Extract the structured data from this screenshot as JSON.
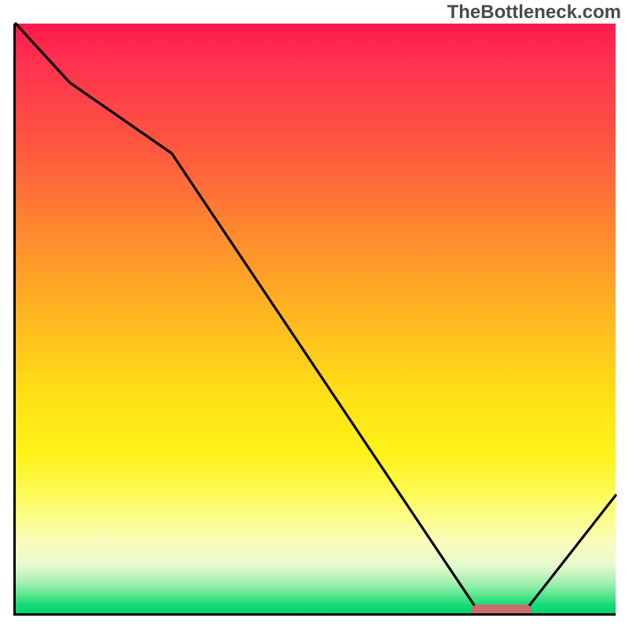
{
  "watermark": "TheBottleneck.com",
  "chart_data": {
    "type": "line",
    "x": [
      0,
      9,
      26,
      77,
      80,
      85,
      100
    ],
    "values": [
      100,
      90,
      78,
      0.5,
      0,
      0.5,
      20
    ],
    "title": "",
    "xlabel": "",
    "ylabel": "",
    "xlim": [
      0,
      100
    ],
    "ylim": [
      0,
      100
    ],
    "annotations": {
      "optimal_marker": {
        "x_start": 76,
        "x_end": 86,
        "y": 0.5
      }
    }
  },
  "colors": {
    "line": "#000000",
    "marker": "#cf6a6a",
    "axis": "#000000"
  }
}
